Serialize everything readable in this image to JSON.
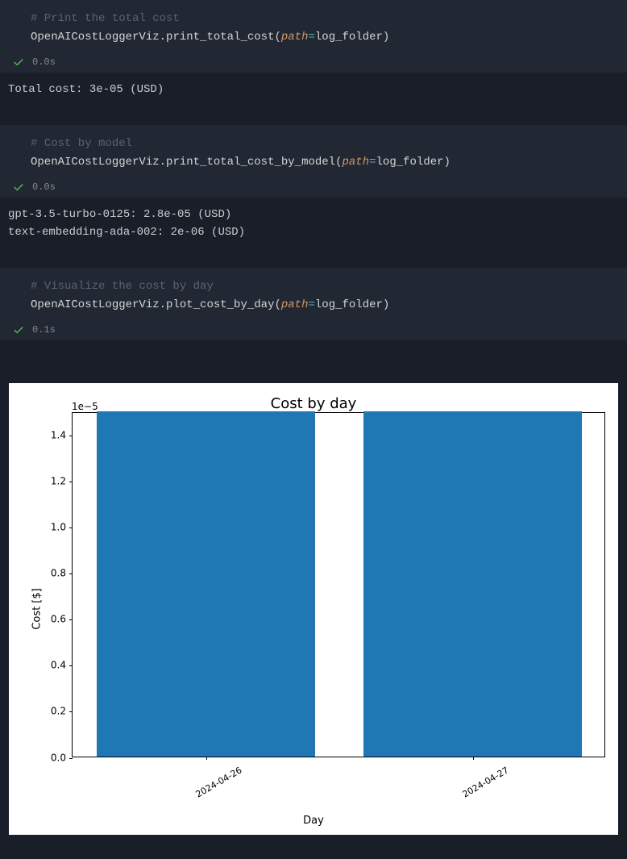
{
  "cells": [
    {
      "comment": "# Print the total cost",
      "class": "OpenAICostLoggerViz",
      "method": "print_total_cost",
      "param": "path",
      "arg": "log_folder",
      "time": "0.0s",
      "output": "Total cost: 3e-05 (USD)"
    },
    {
      "comment": "# Cost by model",
      "class": "OpenAICostLoggerViz",
      "method": "print_total_cost_by_model",
      "param": "path",
      "arg": "log_folder",
      "time": "0.0s",
      "output": "gpt-3.5-turbo-0125: 2.8e-05 (USD)\ntext-embedding-ada-002: 2e-06 (USD)"
    },
    {
      "comment": "# Visualize the cost by day",
      "class": "OpenAICostLoggerViz",
      "method": "plot_cost_by_day",
      "param": "path",
      "arg": "log_folder",
      "time": "0.1s"
    }
  ],
  "chart_data": {
    "type": "bar",
    "title": "Cost by day",
    "xlabel": "Day",
    "ylabel": "Cost [$]",
    "scale_label": "1e−5",
    "categories": [
      "2024-04-26",
      "2024-04-27"
    ],
    "values": [
      1.5e-05,
      1.5e-05
    ],
    "ylim": [
      0,
      1.5e-05
    ],
    "yticks": [
      0.0,
      0.2,
      0.4,
      0.6,
      0.8,
      1.0,
      1.2,
      1.4
    ],
    "ytick_labels": [
      "0.0",
      "0.2",
      "0.4",
      "0.6",
      "0.8",
      "1.0",
      "1.2",
      "1.4"
    ]
  }
}
